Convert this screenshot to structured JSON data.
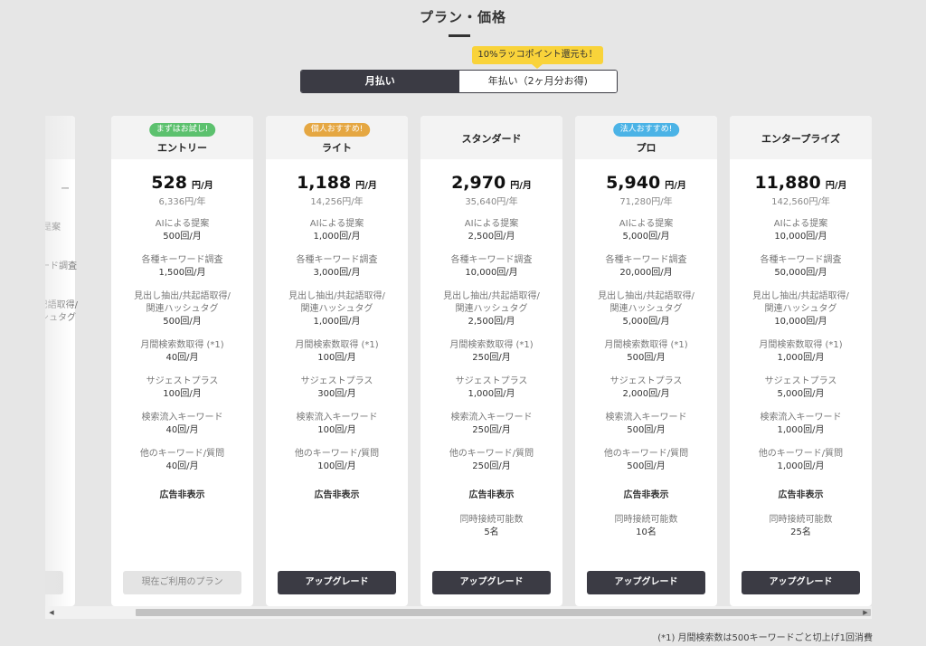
{
  "header": {
    "title": "プラン・価格"
  },
  "promo": {
    "text": "10%ラッコポイント還元も！"
  },
  "billing": {
    "monthly": "月払い",
    "yearly": "年払い（2ヶ月分お得)"
  },
  "partial_card": {
    "lines": [
      "ー",
      "是案",
      "ード調査",
      "記語取得/",
      "ッシュタグ"
    ],
    "button_label": ""
  },
  "plans": [
    {
      "badge": "まずはお試し!",
      "badge_color": "#5cc16e",
      "name": "エントリー",
      "price": "528",
      "price_unit": "円/月",
      "yearly": "6,336円/年",
      "features": [
        {
          "label": "AIによる提案",
          "value": "500回/月"
        },
        {
          "label": "各種キーワード調査",
          "value": "1,500回/月"
        },
        {
          "label": "見出し抽出/共起語取得/\n関連ハッシュタグ",
          "value": "500回/月"
        },
        {
          "label": "月間検索数取得 (*1)",
          "value": "40回/月"
        },
        {
          "label": "サジェストプラス",
          "value": "100回/月"
        },
        {
          "label": "検索流入キーワード",
          "value": "40回/月"
        },
        {
          "label": "他のキーワード/質問",
          "value": "40回/月"
        }
      ],
      "ad_free": "広告非表示",
      "concurrent_label": "",
      "concurrent_value": "",
      "button": "現在ご利用のプラン"
    },
    {
      "badge": "個人おすすめ!",
      "badge_color": "#e5a742",
      "name": "ライト",
      "price": "1,188",
      "price_unit": "円/月",
      "yearly": "14,256円/年",
      "features": [
        {
          "label": "AIによる提案",
          "value": "1,000回/月"
        },
        {
          "label": "各種キーワード調査",
          "value": "3,000回/月"
        },
        {
          "label": "見出し抽出/共起語取得/\n関連ハッシュタグ",
          "value": "1,000回/月"
        },
        {
          "label": "月間検索数取得 (*1)",
          "value": "100回/月"
        },
        {
          "label": "サジェストプラス",
          "value": "300回/月"
        },
        {
          "label": "検索流入キーワード",
          "value": "100回/月"
        },
        {
          "label": "他のキーワード/質問",
          "value": "100回/月"
        }
      ],
      "ad_free": "広告非表示",
      "concurrent_label": "",
      "concurrent_value": "",
      "button": "アップグレード"
    },
    {
      "badge": "",
      "badge_color": "",
      "name": "スタンダード",
      "price": "2,970",
      "price_unit": "円/月",
      "yearly": "35,640円/年",
      "features": [
        {
          "label": "AIによる提案",
          "value": "2,500回/月"
        },
        {
          "label": "各種キーワード調査",
          "value": "10,000回/月"
        },
        {
          "label": "見出し抽出/共起語取得/\n関連ハッシュタグ",
          "value": "2,500回/月"
        },
        {
          "label": "月間検索数取得 (*1)",
          "value": "250回/月"
        },
        {
          "label": "サジェストプラス",
          "value": "1,000回/月"
        },
        {
          "label": "検索流入キーワード",
          "value": "250回/月"
        },
        {
          "label": "他のキーワード/質問",
          "value": "250回/月"
        }
      ],
      "ad_free": "広告非表示",
      "concurrent_label": "同時接続可能数",
      "concurrent_value": "5名",
      "button": "アップグレード"
    },
    {
      "badge": "法人おすすめ!",
      "badge_color": "#4bb3e6",
      "name": "プロ",
      "price": "5,940",
      "price_unit": "円/月",
      "yearly": "71,280円/年",
      "features": [
        {
          "label": "AIによる提案",
          "value": "5,000回/月"
        },
        {
          "label": "各種キーワード調査",
          "value": "20,000回/月"
        },
        {
          "label": "見出し抽出/共起語取得/\n関連ハッシュタグ",
          "value": "5,000回/月"
        },
        {
          "label": "月間検索数取得 (*1)",
          "value": "500回/月"
        },
        {
          "label": "サジェストプラス",
          "value": "2,000回/月"
        },
        {
          "label": "検索流入キーワード",
          "value": "500回/月"
        },
        {
          "label": "他のキーワード/質問",
          "value": "500回/月"
        }
      ],
      "ad_free": "広告非表示",
      "concurrent_label": "同時接続可能数",
      "concurrent_value": "10名",
      "button": "アップグレード"
    },
    {
      "badge": "",
      "badge_color": "",
      "name": "エンタープライズ",
      "price": "11,880",
      "price_unit": "円/月",
      "yearly": "142,560円/年",
      "features": [
        {
          "label": "AIによる提案",
          "value": "10,000回/月"
        },
        {
          "label": "各種キーワード調査",
          "value": "50,000回/月"
        },
        {
          "label": "見出し抽出/共起語取得/\n関連ハッシュタグ",
          "value": "10,000回/月"
        },
        {
          "label": "月間検索数取得 (*1)",
          "value": "1,000回/月"
        },
        {
          "label": "サジェストプラス",
          "value": "5,000回/月"
        },
        {
          "label": "検索流入キーワード",
          "value": "1,000回/月"
        },
        {
          "label": "他のキーワード/質問",
          "value": "1,000回/月"
        }
      ],
      "ad_free": "広告非表示",
      "concurrent_label": "同時接続可能数",
      "concurrent_value": "25名",
      "button": "アップグレード"
    }
  ],
  "scrollbar": {
    "left_icon": "◀",
    "right_icon": "▶"
  },
  "footnote": "(*1) 月間検索数は500キーワードごと切上げ1回消費"
}
